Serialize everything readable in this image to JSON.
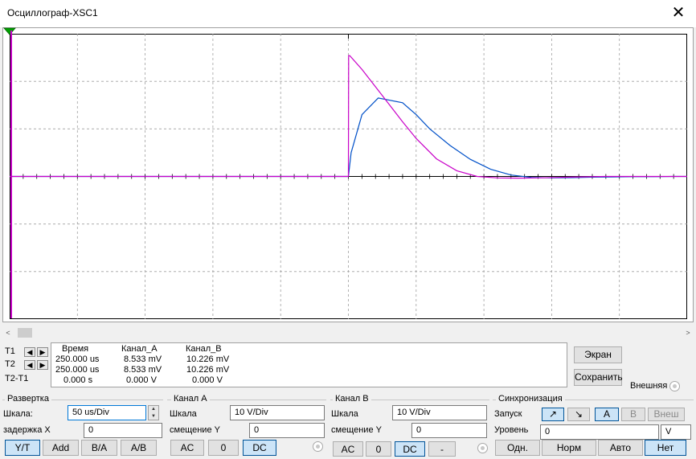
{
  "window": {
    "title": "Осциллограф-XSC1",
    "close_glyph": "✕"
  },
  "colors": {
    "channel_a": "#0050c8",
    "channel_b": "#c800c8",
    "grid": "#a0a0a0",
    "axis": "#000000"
  },
  "chart_data": {
    "type": "line",
    "x_label": "",
    "y_label": "",
    "grid": true,
    "x_divisions": 10,
    "y_divisions": 6,
    "timebase": "50 us/Div",
    "volts_per_div": "10 V/Div",
    "x_unit": "us",
    "y_unit": "V",
    "xlim": [
      0,
      500
    ],
    "ylim": [
      -30,
      30
    ],
    "series": [
      {
        "key": "channel_a",
        "color": "#0050c8",
        "x": [
          0,
          250,
          252,
          260,
          272,
          290,
          300,
          310,
          325,
          340,
          355,
          370,
          385,
          400,
          415,
          430,
          445,
          460,
          475,
          490,
          500
        ],
        "y": [
          0,
          0,
          5,
          13,
          16.5,
          15.5,
          13,
          10,
          6.5,
          3.6,
          1.5,
          0.3,
          -0.2,
          -0.3,
          -0.25,
          -0.15,
          -0.1,
          -0.05,
          -0.05,
          0,
          0
        ]
      },
      {
        "key": "channel_b",
        "color": "#c800c8",
        "x": [
          0,
          250,
          250.2,
          251,
          260,
          275,
          290,
          300,
          315,
          330,
          345,
          360,
          375,
          390,
          405,
          420,
          440,
          460,
          480,
          500
        ],
        "y": [
          0,
          0,
          25.4,
          25.4,
          22.5,
          17,
          11.5,
          8,
          3.7,
          1.2,
          0,
          -0.3,
          -0.35,
          -0.3,
          -0.2,
          -0.1,
          0,
          0,
          0,
          0
        ]
      }
    ],
    "trigger_marker_color": "#00a000"
  },
  "scroll": {
    "left_arrow": "<",
    "right_arrow": ">"
  },
  "measurements": {
    "row_labels": [
      "T1",
      "T2",
      "T2-T1"
    ],
    "headers": [
      "Время",
      "Канал_A",
      "Канал_B"
    ],
    "rows": [
      [
        "250.000 us",
        "8.533 mV",
        "10.226 mV"
      ],
      [
        "250.000 us",
        "8.533 mV",
        "10.226 mV"
      ],
      [
        "0.000 s",
        "0.000 V",
        "0.000 V"
      ]
    ],
    "cursor_left_glyph": "◀",
    "cursor_right_glyph": "▶"
  },
  "actions": {
    "screen_button": "Экран",
    "save_button": "Сохранить",
    "external_label": "Внешняя"
  },
  "timebase": {
    "title": "Развертка",
    "scale_label": "Шкала:",
    "scale_value": "50 us/Div",
    "delay_label": "задержка X",
    "delay_value": "0",
    "modes": [
      "Y/T",
      "Add",
      "B/A",
      "A/B"
    ],
    "selected_mode": "Y/T"
  },
  "channel_a": {
    "title": "Канал A",
    "scale_label": "Шкала",
    "scale_value": "10  V/Div",
    "offset_label": "смещение Y",
    "offset_value": "0",
    "coupling": [
      "AC",
      "0",
      "DC"
    ],
    "selected_coupling": "DC"
  },
  "channel_b": {
    "title": "Канал B",
    "scale_label": "Шкала",
    "scale_value": "10  V/Div",
    "offset_label": "смещение Y",
    "offset_value": "0",
    "coupling": [
      "AC",
      "0",
      "DC",
      "-"
    ],
    "selected_coupling": "DC"
  },
  "trigger": {
    "title": "Синхронизация",
    "start_label": "Запуск",
    "edge_rising": "↗",
    "edge_falling": "↘",
    "sources": [
      "A",
      "B",
      "Внеш"
    ],
    "selected_source": "A",
    "level_label": "Уровень",
    "level_value": "0",
    "level_unit": "V",
    "modes": [
      "Одн.",
      "Норм",
      "Авто",
      "Нет"
    ],
    "selected_mode": "Нет"
  }
}
